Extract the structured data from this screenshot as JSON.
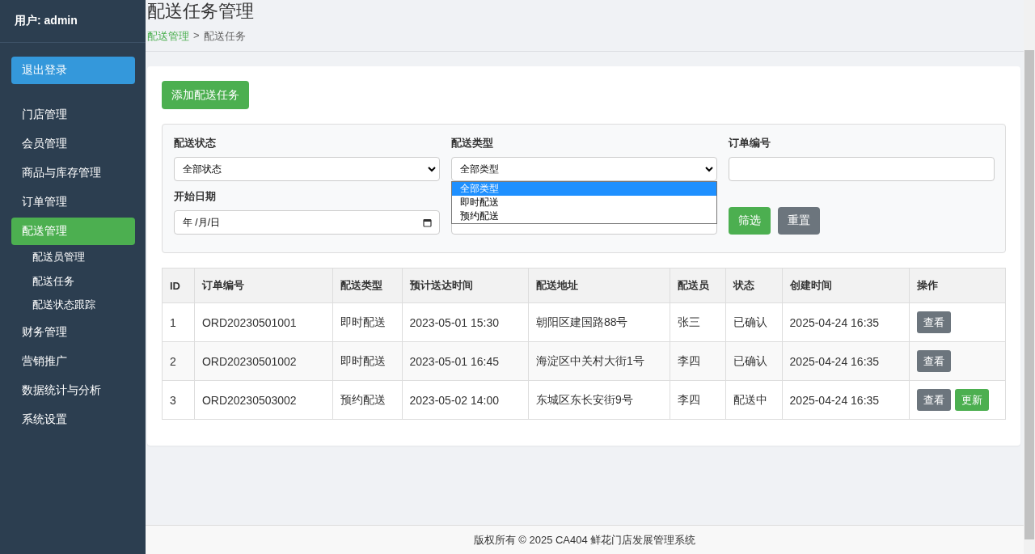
{
  "sidebar": {
    "user": "用户: admin",
    "logout": "退出登录",
    "items": [
      {
        "label": "门店管理",
        "selected": false
      },
      {
        "label": "会员管理",
        "selected": false
      },
      {
        "label": "商品与库存管理",
        "selected": false
      },
      {
        "label": "订单管理",
        "selected": false
      },
      {
        "label": "配送管理",
        "selected": true,
        "children": [
          {
            "label": "配送员管理"
          },
          {
            "label": "配送任务"
          },
          {
            "label": "配送状态跟踪"
          }
        ]
      },
      {
        "label": "财务管理",
        "selected": false
      },
      {
        "label": "营销推广",
        "selected": false
      },
      {
        "label": "数据统计与分析",
        "selected": false
      },
      {
        "label": "系统设置",
        "selected": false
      }
    ]
  },
  "header": {
    "title": "配送任务管理",
    "breadcrumb": [
      {
        "label": "配送管理",
        "kind": "link"
      },
      {
        "label": ">",
        "kind": "separator"
      },
      {
        "label": "配送任务",
        "kind": "current"
      }
    ]
  },
  "add_button": "添加配送任务",
  "filters": {
    "status": {
      "label": "配送状态",
      "value": "全部状态"
    },
    "type": {
      "label": "配送类型",
      "value": "全部类型",
      "expanded": true,
      "options": [
        {
          "label": "全部类型",
          "selected": true
        },
        {
          "label": "即时配送",
          "selected": false
        },
        {
          "label": "预约配送",
          "selected": false
        }
      ]
    },
    "order_no": {
      "label": "订单编号"
    },
    "start_date": {
      "label": "开始日期",
      "value": "年 /月/日"
    },
    "buttons": [
      {
        "label": "筛选",
        "kind": "primary"
      },
      {
        "label": "重置",
        "kind": "secondary"
      }
    ]
  },
  "table": {
    "columns": [
      "ID",
      "订单编号",
      "配送类型",
      "预计送达时间",
      "配送地址",
      "配送员",
      "状态",
      "创建时间",
      "操作"
    ],
    "rows": [
      {
        "cells": [
          "1",
          "ORD20230501001",
          "即时配送",
          "2023-05-01 15:30",
          "朝阳区建国路88号",
          "张三",
          "已确认",
          "2025-04-24 16:35"
        ],
        "actions": [
          {
            "label": "查看",
            "kind": "view"
          }
        ]
      },
      {
        "cells": [
          "2",
          "ORD20230501002",
          "即时配送",
          "2023-05-01 16:45",
          "海淀区中关村大街1号",
          "李四",
          "已确认",
          "2025-04-24 16:35"
        ],
        "actions": [
          {
            "label": "查看",
            "kind": "view"
          }
        ]
      },
      {
        "cells": [
          "3",
          "ORD20230503002",
          "预约配送",
          "2023-05-02 14:00",
          "东城区东长安街9号",
          "李四",
          "配送中",
          "2025-04-24 16:35"
        ],
        "actions": [
          {
            "label": "查看",
            "kind": "view"
          },
          {
            "label": "更新",
            "kind": "update"
          }
        ]
      }
    ]
  },
  "footer": "版权所有 © 2025 CA404 鲜花门店发展管理系统"
}
